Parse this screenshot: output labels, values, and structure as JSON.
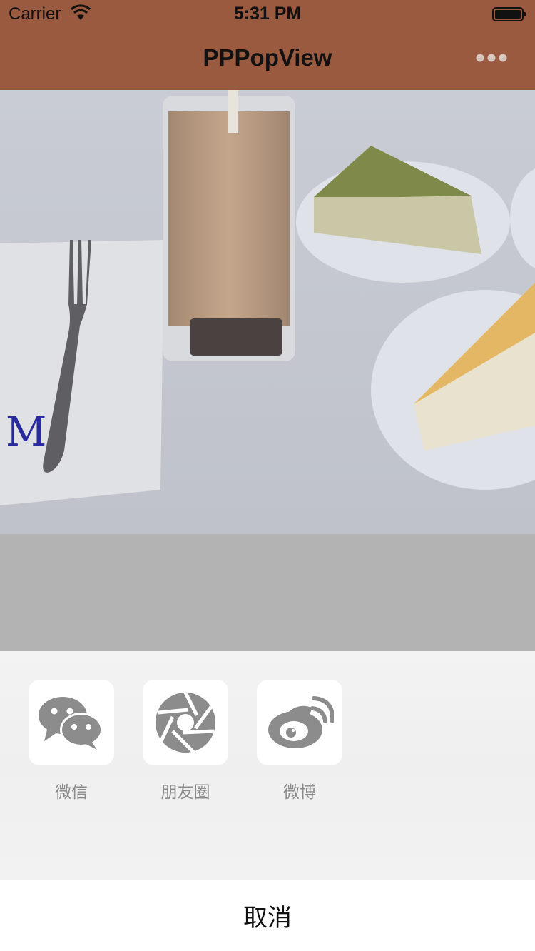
{
  "status_bar": {
    "carrier": "Carrier",
    "time": "5:31 PM"
  },
  "nav": {
    "title": "PPPopView",
    "more_icon": "ellipsis-icon"
  },
  "colors": {
    "nav_background": "#9a5a40",
    "dim_overlay": "#b3b3b3",
    "sheet_background": "#f2f2f2",
    "icon_gray": "#8c8c8c"
  },
  "photo": {
    "icon": "photo-cake-and-iced-drink"
  },
  "share_sheet": {
    "items": [
      {
        "label": "微信",
        "icon": "wechat-icon"
      },
      {
        "label": "朋友圈",
        "icon": "moments-shutter-icon"
      },
      {
        "label": "微博",
        "icon": "weibo-icon"
      }
    ],
    "cancel_label": "取消"
  }
}
